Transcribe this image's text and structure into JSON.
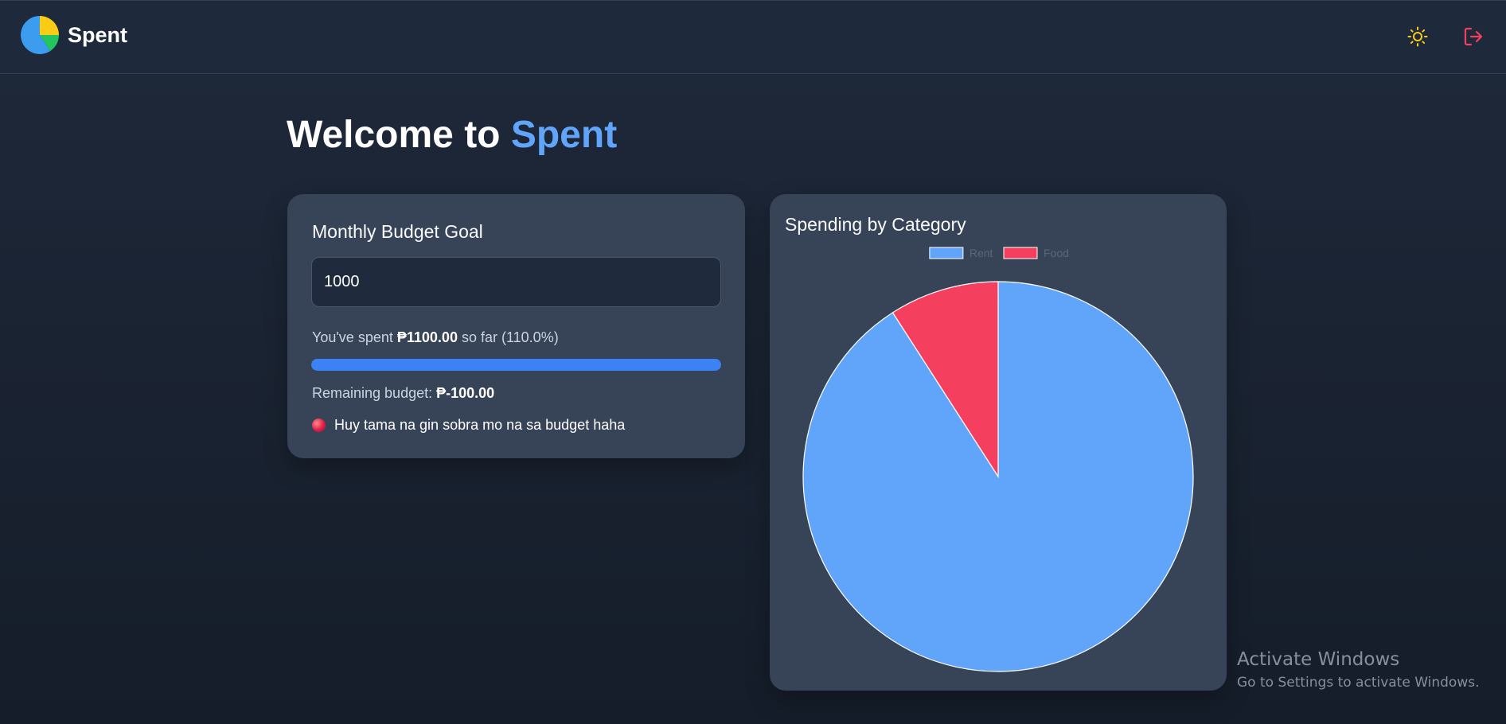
{
  "app": {
    "name": "Spent",
    "logo_icon": "pie-chart-logo",
    "accent_color": "#60a5fa"
  },
  "header": {
    "theme_toggle_icon": "sun-icon",
    "logout_icon": "logout-icon"
  },
  "welcome": {
    "prefix": "Welcome to",
    "brand": "Spent"
  },
  "budget": {
    "heading": "Monthly Budget Goal",
    "goal_value": "1000",
    "spent_prefix": "You've spent",
    "spent_amount": "₱1100.00",
    "spent_suffix": "so far (110.0%)",
    "progress_percent": 100,
    "remaining_label": "Remaining budget:",
    "remaining_amount": "₱-100.00",
    "warning_text": "Huy tama na gin sobra mo na sa budget haha",
    "warning_icon": "red-circle-icon"
  },
  "chart": {
    "heading": "Spending by Category"
  },
  "chart_data": {
    "type": "pie",
    "title": "Spending by Category",
    "legend_position": "top",
    "slices": [
      {
        "label": "Rent",
        "value": 1000,
        "color": "#60a5fa"
      },
      {
        "label": "Food",
        "value": 100,
        "color": "#f43f5e"
      }
    ]
  },
  "watermark": {
    "title": "Activate Windows",
    "subtitle": "Go to Settings to activate Windows."
  }
}
